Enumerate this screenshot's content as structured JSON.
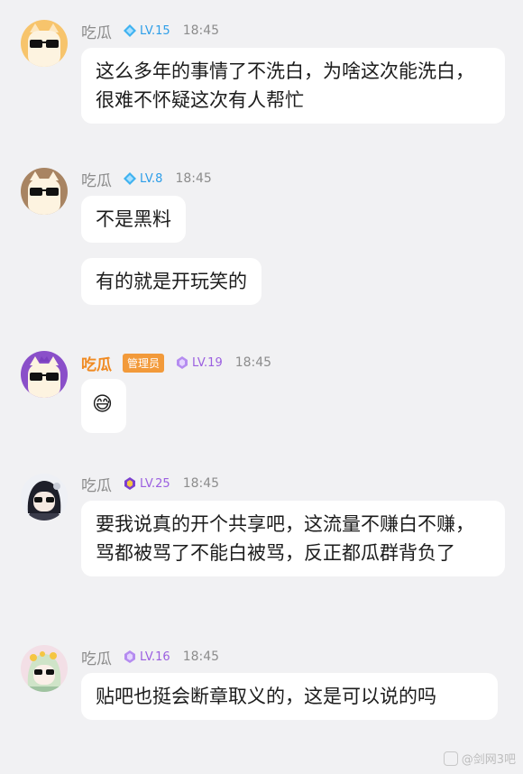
{
  "messages": [
    {
      "sender": "吃瓜",
      "level": "LV.15",
      "time": "18:45",
      "texts": [
        "这么多年的事情了不洗白，为啥这次能洗白，很难不怀疑这次有人帮忙"
      ]
    },
    {
      "sender": "吃瓜",
      "level": "LV.8",
      "time": "18:45",
      "texts": [
        "不是黑料",
        "有的就是开玩笑的"
      ]
    },
    {
      "sender": "吃瓜",
      "role": "管理员",
      "level": "LV.19",
      "time": "18:45",
      "texts": [
        "😅"
      ]
    },
    {
      "sender": "吃瓜",
      "level": "LV.25",
      "time": "18:45",
      "texts": [
        "要我说真的开个共享吧，这流量不赚白不赚，骂都被骂了不能白被骂，反正都瓜群背负了"
      ]
    },
    {
      "sender": "吃瓜",
      "level": "LV.16",
      "time": "18:45",
      "texts": [
        "贴吧也挺会断章取义的，这是可以说的吗"
      ]
    }
  ],
  "watermark": "@剑网3吧",
  "colors": {
    "background": "#f1f1f3",
    "bubble": "#ffffff",
    "level_blue": "#2d9ee8",
    "level_purple": "#9b5fe0",
    "admin_orange": "#f29a3a"
  }
}
